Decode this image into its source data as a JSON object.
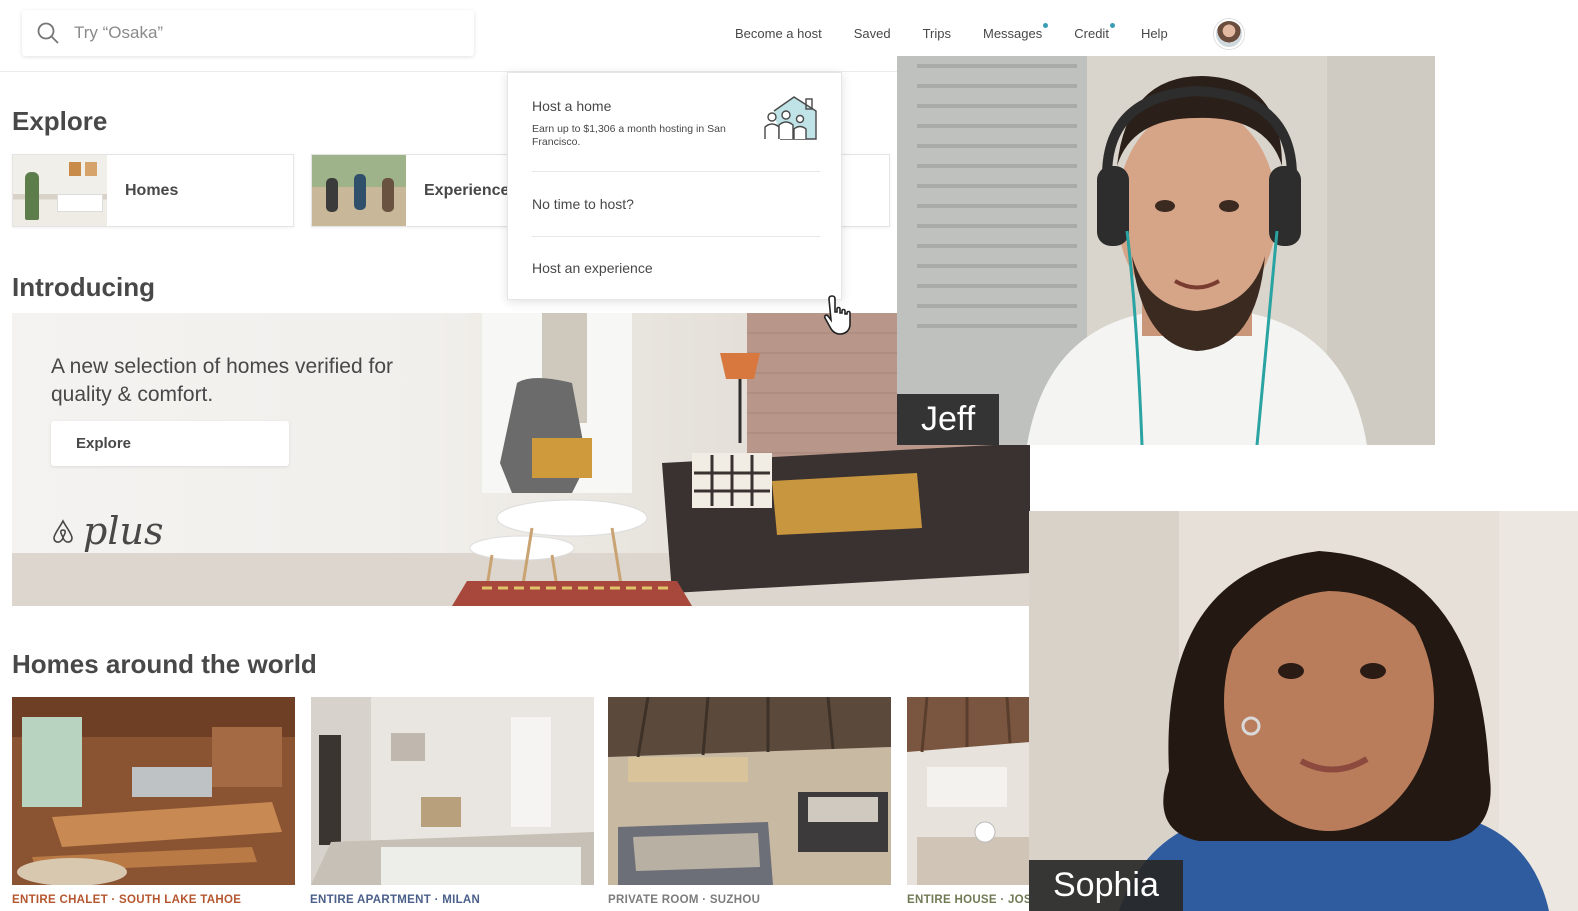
{
  "search": {
    "placeholder": "Try “Osaka”"
  },
  "nav": {
    "items": [
      {
        "label": "Become a host",
        "dot": false
      },
      {
        "label": "Saved",
        "dot": false
      },
      {
        "label": "Trips",
        "dot": false
      },
      {
        "label": "Messages",
        "dot": true
      },
      {
        "label": "Credit",
        "dot": true
      },
      {
        "label": "Help",
        "dot": false
      }
    ],
    "notification_dot_color": "#3a9db5"
  },
  "explore": {
    "heading": "Explore",
    "cards": [
      {
        "label": "Homes"
      },
      {
        "label": "Experience"
      }
    ]
  },
  "dropdown": {
    "host_home_title": "Host a home",
    "host_home_sub": "Earn up to $1,306 a month hosting in San Francisco.",
    "no_time": "No time to host?",
    "host_experience": "Host an experience",
    "illustration_icon": "house-family-icon"
  },
  "introducing": {
    "heading": "Introducing",
    "text": "A new selection of homes verified for quality & comfort.",
    "button": "Explore",
    "brand": "plus"
  },
  "homes": {
    "heading": "Homes around the world",
    "items": [
      {
        "caption": "ENTIRE CHALET · SOUTH LAKE TAHOE",
        "color": "#b5562f"
      },
      {
        "caption": "ENTIRE APARTMENT · MILAN",
        "color": "#4a5f8a"
      },
      {
        "caption": "PRIVATE ROOM · SUZHOU",
        "color": "#7c7c7c"
      },
      {
        "caption": "ENTIRE HOUSE · JOSHUA TREE",
        "color": "#6f7a55"
      }
    ]
  },
  "video_call": {
    "participants": [
      {
        "name": "Jeff"
      },
      {
        "name": "Sophia"
      }
    ]
  }
}
